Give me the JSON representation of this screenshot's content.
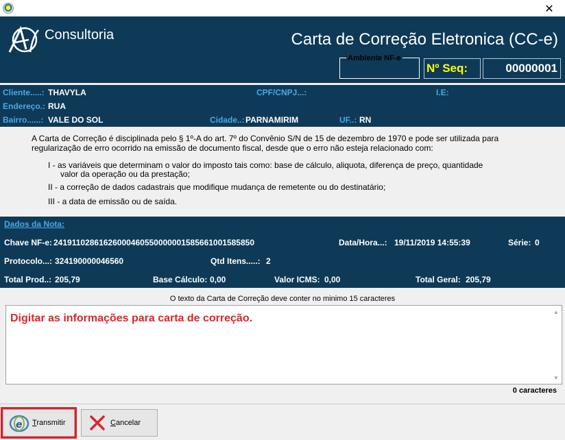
{
  "window": {
    "close_label": "✕"
  },
  "header": {
    "brand": "Consultoria",
    "title": "Carta de Correção Eletronica (CC-e)",
    "env_label": "Ambiente NF-e",
    "seq_label": "Nº Seq:",
    "seq_value": "00000001"
  },
  "client": {
    "cliente_label": "Cliente.....:",
    "cliente_value": "THAVYLA",
    "cpf_label": "CPF/CNPJ...:",
    "ie_label": "I.E:",
    "endereco_label": "Endereço.:",
    "endereco_value": "RUA",
    "bairro_label": "Bairro......:",
    "bairro_value": "VALE DO SOL",
    "cidade_label": "Cidade..:",
    "cidade_value": "PARNAMIRIM",
    "uf_label": "UF..:",
    "uf_value": "RN"
  },
  "legal": {
    "para1_line1": "A Carta de Correção é disciplinada pelo § 1º-A do art. 7º do Convênio  S/N de 15 de dezembro de 1970 e pode ser utilizada para",
    "para1_line2": "regularização de erro ocorrido na emissão de documento fiscal, desde que o erro não esteja relacionado com:",
    "item1_line1": "I - as variáveis que determinam o valor do imposto tais como: base de cálculo, aliquota, diferença de preço, quantidade",
    "item1_line2": "valor da operação ou da prestação;",
    "item2": "II - a correção de dados cadastrais que modifique mudança de remetente ou do destinatário;",
    "item3": "III - a data de emissão ou de saída."
  },
  "nota": {
    "title": "Dados da Nota:",
    "chave_label": "Chave NF-e:",
    "chave_value": "24191102861626000460550000001585661001585850",
    "data_label": "Data/Hora...:",
    "data_value": "19/11/2019 14:55:39",
    "serie_label": "Série:",
    "serie_value": "0",
    "protocolo_label": "Protocolo...:",
    "protocolo_value": "324190000046560",
    "qtd_label": "Qtd Itens.....:",
    "qtd_value": "2",
    "total_prod_label": "Total Prod..:",
    "total_prod_value": "205,79",
    "base_label": "Base Cálculo:",
    "base_value": "0,00",
    "icms_label": "Valor ICMS:",
    "icms_value": "0,00",
    "total_geral_label": "Total Geral:",
    "total_geral_value": "205,79"
  },
  "correction": {
    "hint": "O texto da Carta de Correção deve conter no minimo 15 caracteres",
    "text": "Digitar as informações para carta de correção.",
    "counter": "0 caracteres"
  },
  "buttons": {
    "transmit_first": "T",
    "transmit_rest": "ransmitir",
    "cancel_first": "C",
    "cancel_rest": "ancelar"
  },
  "colors": {
    "header_bg": "#0e3a57",
    "label_blue": "#4aa8e8",
    "seq_yellow": "#ffff00",
    "highlight_red": "#e01e26",
    "text_red": "#d9262c"
  }
}
